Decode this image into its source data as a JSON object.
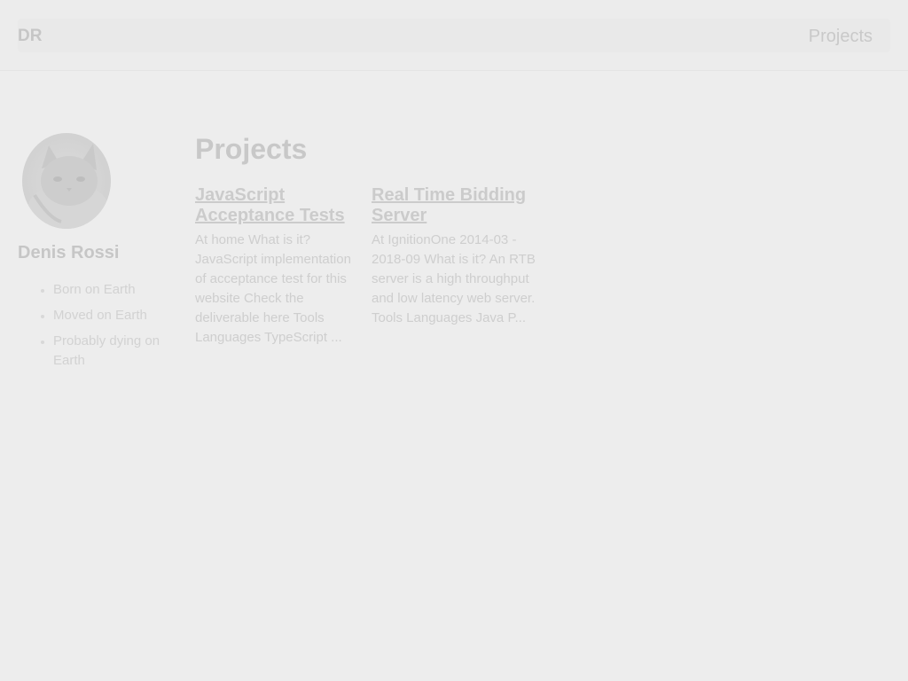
{
  "header": {
    "brand": "DR",
    "nav_links": [
      {
        "label": "Projects"
      }
    ]
  },
  "sidebar": {
    "avatar_icon": "cat-photo-avatar",
    "name": "Denis Rossi",
    "facts": [
      "Born on Earth",
      "Moved on Earth",
      "Probably dying on Earth"
    ]
  },
  "main": {
    "title": "Projects",
    "projects": [
      {
        "title": "JavaScript Acceptance Tests",
        "excerpt": "At home What is it? JavaScript implementation of acceptance test for this website Check the deliverable here Tools Languages TypeScript ..."
      },
      {
        "title": "Real Time Bidding Server",
        "excerpt": "At IgnitionOne 2014-03 - 2018-09 What is it? An RTB server is a high throughput and low latency web server. Tools Languages Java P..."
      }
    ]
  }
}
